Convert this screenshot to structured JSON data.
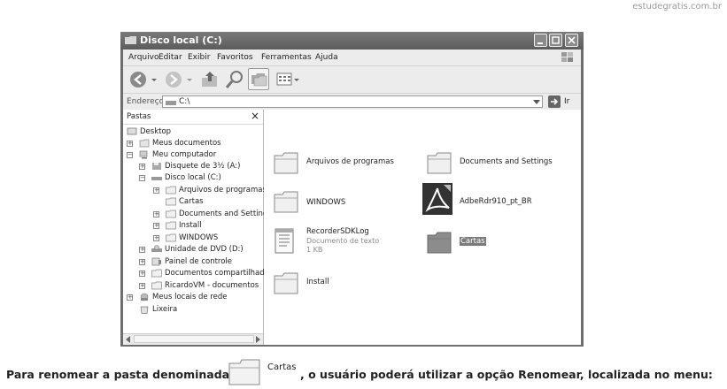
{
  "watermark": "estudegratis.com.br",
  "window": {
    "title": "Disco local (C:)",
    "menu": [
      "Arquivo",
      "Editar",
      "Exibir",
      "Favoritos",
      "Ferramentas",
      "Ajuda"
    ],
    "address_label": "Endereço",
    "address_value": "C:\\",
    "go_label": "Ir"
  },
  "left_pane": {
    "title": "Pastas",
    "close": "×",
    "tree": [
      {
        "label": "Desktop",
        "icon": "desktop-icon"
      },
      {
        "label": "Meus documentos",
        "icon": "documents-icon",
        "expand": "+"
      },
      {
        "label": "Meu computador",
        "icon": "computer-icon",
        "expand": "−"
      },
      {
        "label": "Disquete de 3½ (A:)",
        "icon": "floppy-icon",
        "expand": "+"
      },
      {
        "label": "Disco local (C:)",
        "icon": "drive-icon",
        "expand": "−"
      },
      {
        "label": "Arquivos de programas",
        "icon": "folder-icon",
        "expand": "+"
      },
      {
        "label": "Cartas",
        "icon": "folder-icon"
      },
      {
        "label": "Documents and Settings",
        "icon": "folder-icon",
        "expand": "+"
      },
      {
        "label": "Install",
        "icon": "folder-icon",
        "expand": "+"
      },
      {
        "label": "WINDOWS",
        "icon": "folder-icon",
        "expand": "+"
      },
      {
        "label": "Unidade de DVD (D:)",
        "icon": "dvd-icon",
        "expand": "+"
      },
      {
        "label": "Painel de controle",
        "icon": "control-panel-icon",
        "expand": "+"
      },
      {
        "label": "Documentos compartilhados",
        "icon": "folder-icon",
        "expand": "+"
      },
      {
        "label": "RicardoVM - documentos",
        "icon": "folder-icon",
        "expand": "+"
      },
      {
        "label": "Meus locais de rede",
        "icon": "network-icon",
        "expand": "+"
      },
      {
        "label": "Lixeira",
        "icon": "recycle-bin-icon"
      }
    ]
  },
  "files": [
    {
      "name": "Arquivos de programas",
      "icon": "folder-icon"
    },
    {
      "name": "Documents and Settings",
      "icon": "folder-icon"
    },
    {
      "name": "WINDOWS",
      "icon": "folder-icon"
    },
    {
      "name": "AdbeRdr910_pt_BR",
      "icon": "acrobat-icon"
    },
    {
      "name": "RecorderSDKLog",
      "type": "Documento de texto",
      "size": "1 KB",
      "icon": "text-file-icon"
    },
    {
      "name": "Cartas",
      "icon": "folder-icon",
      "selected": true
    },
    {
      "name": "Install",
      "icon": "folder-icon"
    }
  ],
  "question": {
    "part1": "Para renomear a pasta denominada",
    "folder_label": "Cartas",
    "part2": ", o usuário poderá utilizar a opção Renomear, localizada no menu:"
  }
}
